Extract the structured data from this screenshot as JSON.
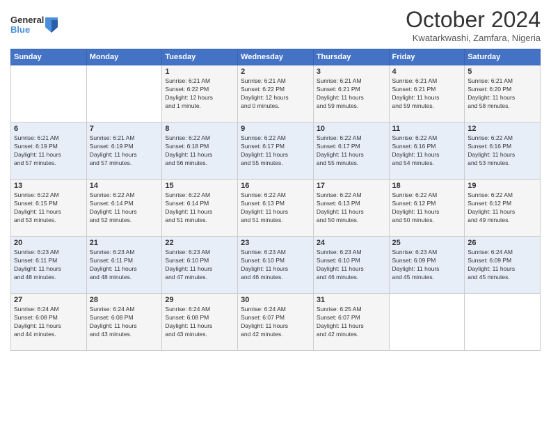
{
  "header": {
    "logo_line1": "General",
    "logo_line2": "Blue",
    "month": "October 2024",
    "location": "Kwatarkwashi, Zamfara, Nigeria"
  },
  "days_of_week": [
    "Sunday",
    "Monday",
    "Tuesday",
    "Wednesday",
    "Thursday",
    "Friday",
    "Saturday"
  ],
  "weeks": [
    [
      {
        "day": "",
        "info": ""
      },
      {
        "day": "",
        "info": ""
      },
      {
        "day": "1",
        "info": "Sunrise: 6:21 AM\nSunset: 6:22 PM\nDaylight: 12 hours\nand 1 minute."
      },
      {
        "day": "2",
        "info": "Sunrise: 6:21 AM\nSunset: 6:22 PM\nDaylight: 12 hours\nand 0 minutes."
      },
      {
        "day": "3",
        "info": "Sunrise: 6:21 AM\nSunset: 6:21 PM\nDaylight: 11 hours\nand 59 minutes."
      },
      {
        "day": "4",
        "info": "Sunrise: 6:21 AM\nSunset: 6:21 PM\nDaylight: 11 hours\nand 59 minutes."
      },
      {
        "day": "5",
        "info": "Sunrise: 6:21 AM\nSunset: 6:20 PM\nDaylight: 11 hours\nand 58 minutes."
      }
    ],
    [
      {
        "day": "6",
        "info": "Sunrise: 6:21 AM\nSunset: 6:19 PM\nDaylight: 11 hours\nand 57 minutes."
      },
      {
        "day": "7",
        "info": "Sunrise: 6:21 AM\nSunset: 6:19 PM\nDaylight: 11 hours\nand 57 minutes."
      },
      {
        "day": "8",
        "info": "Sunrise: 6:22 AM\nSunset: 6:18 PM\nDaylight: 11 hours\nand 56 minutes."
      },
      {
        "day": "9",
        "info": "Sunrise: 6:22 AM\nSunset: 6:17 PM\nDaylight: 11 hours\nand 55 minutes."
      },
      {
        "day": "10",
        "info": "Sunrise: 6:22 AM\nSunset: 6:17 PM\nDaylight: 11 hours\nand 55 minutes."
      },
      {
        "day": "11",
        "info": "Sunrise: 6:22 AM\nSunset: 6:16 PM\nDaylight: 11 hours\nand 54 minutes."
      },
      {
        "day": "12",
        "info": "Sunrise: 6:22 AM\nSunset: 6:16 PM\nDaylight: 11 hours\nand 53 minutes."
      }
    ],
    [
      {
        "day": "13",
        "info": "Sunrise: 6:22 AM\nSunset: 6:15 PM\nDaylight: 11 hours\nand 53 minutes."
      },
      {
        "day": "14",
        "info": "Sunrise: 6:22 AM\nSunset: 6:14 PM\nDaylight: 11 hours\nand 52 minutes."
      },
      {
        "day": "15",
        "info": "Sunrise: 6:22 AM\nSunset: 6:14 PM\nDaylight: 11 hours\nand 51 minutes."
      },
      {
        "day": "16",
        "info": "Sunrise: 6:22 AM\nSunset: 6:13 PM\nDaylight: 11 hours\nand 51 minutes."
      },
      {
        "day": "17",
        "info": "Sunrise: 6:22 AM\nSunset: 6:13 PM\nDaylight: 11 hours\nand 50 minutes."
      },
      {
        "day": "18",
        "info": "Sunrise: 6:22 AM\nSunset: 6:12 PM\nDaylight: 11 hours\nand 50 minutes."
      },
      {
        "day": "19",
        "info": "Sunrise: 6:22 AM\nSunset: 6:12 PM\nDaylight: 11 hours\nand 49 minutes."
      }
    ],
    [
      {
        "day": "20",
        "info": "Sunrise: 6:23 AM\nSunset: 6:11 PM\nDaylight: 11 hours\nand 48 minutes."
      },
      {
        "day": "21",
        "info": "Sunrise: 6:23 AM\nSunset: 6:11 PM\nDaylight: 11 hours\nand 48 minutes."
      },
      {
        "day": "22",
        "info": "Sunrise: 6:23 AM\nSunset: 6:10 PM\nDaylight: 11 hours\nand 47 minutes."
      },
      {
        "day": "23",
        "info": "Sunrise: 6:23 AM\nSunset: 6:10 PM\nDaylight: 11 hours\nand 46 minutes."
      },
      {
        "day": "24",
        "info": "Sunrise: 6:23 AM\nSunset: 6:10 PM\nDaylight: 11 hours\nand 46 minutes."
      },
      {
        "day": "25",
        "info": "Sunrise: 6:23 AM\nSunset: 6:09 PM\nDaylight: 11 hours\nand 45 minutes."
      },
      {
        "day": "26",
        "info": "Sunrise: 6:24 AM\nSunset: 6:09 PM\nDaylight: 11 hours\nand 45 minutes."
      }
    ],
    [
      {
        "day": "27",
        "info": "Sunrise: 6:24 AM\nSunset: 6:08 PM\nDaylight: 11 hours\nand 44 minutes."
      },
      {
        "day": "28",
        "info": "Sunrise: 6:24 AM\nSunset: 6:08 PM\nDaylight: 11 hours\nand 43 minutes."
      },
      {
        "day": "29",
        "info": "Sunrise: 6:24 AM\nSunset: 6:08 PM\nDaylight: 11 hours\nand 43 minutes."
      },
      {
        "day": "30",
        "info": "Sunrise: 6:24 AM\nSunset: 6:07 PM\nDaylight: 11 hours\nand 42 minutes."
      },
      {
        "day": "31",
        "info": "Sunrise: 6:25 AM\nSunset: 6:07 PM\nDaylight: 11 hours\nand 42 minutes."
      },
      {
        "day": "",
        "info": ""
      },
      {
        "day": "",
        "info": ""
      }
    ]
  ]
}
